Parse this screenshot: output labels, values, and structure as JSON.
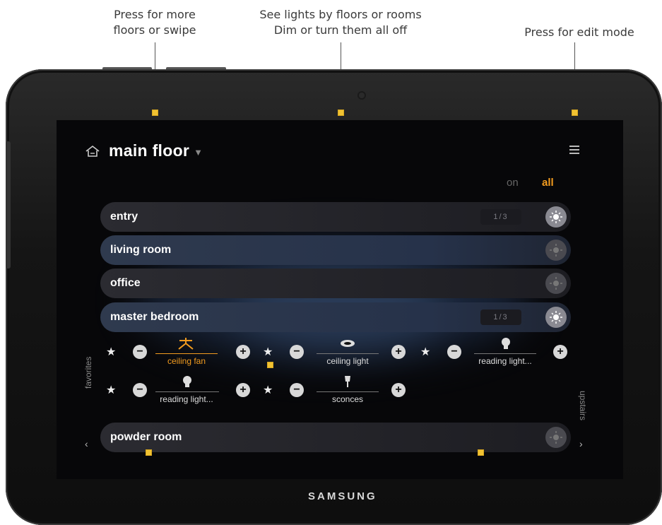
{
  "annotations": {
    "left": [
      "Press for more",
      "floors or swipe"
    ],
    "center": [
      "See lights by floors or rooms",
      "Dim or turn them all off"
    ],
    "right": "Press for edit mode"
  },
  "device": {
    "brand": "SAMSUNG"
  },
  "app": {
    "header": {
      "title": "main floor",
      "home_icon": "home-icon",
      "menu_icon": "hamburger-menu-icon"
    },
    "filter": {
      "on_label": "on",
      "all_label": "all",
      "selected": "all"
    },
    "rooms": [
      {
        "name": "entry",
        "count": "1/3",
        "state": "on"
      },
      {
        "name": "living room",
        "count": "",
        "state": "off"
      },
      {
        "name": "office",
        "count": "",
        "state": "off"
      },
      {
        "name": "master bedroom",
        "count": "1/3",
        "state": "on"
      },
      {
        "name": "powder room",
        "count": "",
        "state": "off"
      }
    ],
    "devices": [
      {
        "label": "ceiling fan",
        "icon": "ceiling-fan-icon",
        "active": true
      },
      {
        "label": "ceiling light",
        "icon": "ceiling-light-icon",
        "active": false
      },
      {
        "label": "reading light...",
        "icon": "lamp-icon",
        "active": false
      },
      {
        "label": "reading light...",
        "icon": "lamp-icon",
        "active": false
      },
      {
        "label": "sconces",
        "icon": "sconce-icon",
        "active": false
      }
    ],
    "side_nav": {
      "left": "favorites",
      "right": "upstairs"
    },
    "colors": {
      "accent": "#f39c1f",
      "background": "#070709",
      "row": "#2b2b31",
      "row_highlight": "#2f3a4e"
    }
  }
}
